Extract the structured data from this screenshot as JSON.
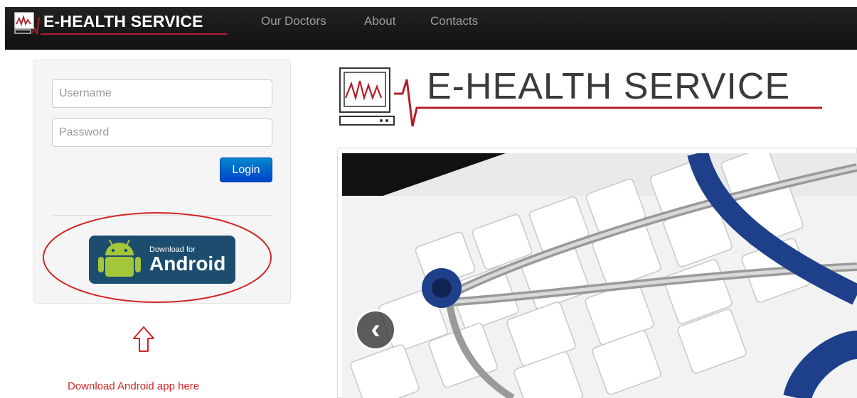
{
  "navbar": {
    "brand": "E-HEALTH SERVICE",
    "items": [
      {
        "label": "Our Doctors"
      },
      {
        "label": "About"
      },
      {
        "label": "Contacts"
      }
    ]
  },
  "login": {
    "username_placeholder": "Username",
    "password_placeholder": "Password",
    "login_label": "Login"
  },
  "android_badge": {
    "small_text": "Download for",
    "big_text": "Android"
  },
  "annotation": {
    "text": "Download Android app here"
  },
  "header_logo": {
    "text": "E-HEALTH SERVICE"
  },
  "carousel": {
    "prev_glyph": "‹"
  },
  "colors": {
    "brand_red": "#b31e2a",
    "navbar_bg": "#1b1b1b",
    "login_blue": "#0055cc",
    "android_green": "#a4c639",
    "android_badge_bg": "#1d4d6e",
    "annotation_red": "#d22424"
  }
}
